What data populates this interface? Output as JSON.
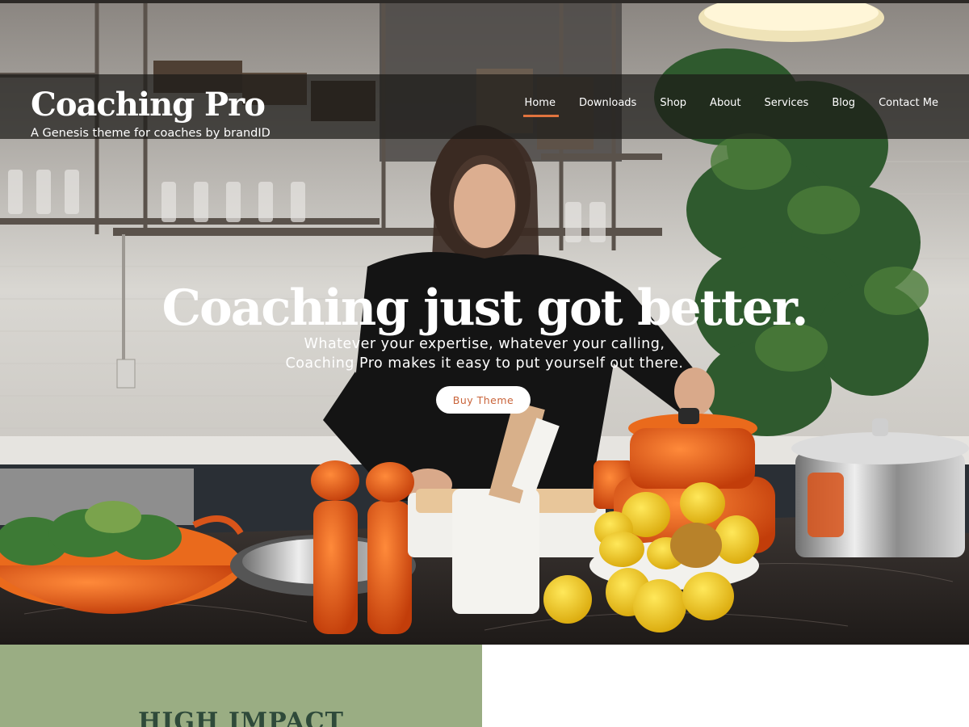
{
  "site": {
    "title": "Coaching Pro",
    "tagline": "A Genesis theme for coaches by brandID"
  },
  "nav": {
    "items": [
      {
        "label": "Home",
        "active": true
      },
      {
        "label": "Downloads",
        "active": false
      },
      {
        "label": "Shop",
        "active": false
      },
      {
        "label": "About",
        "active": false
      },
      {
        "label": "Services",
        "active": false
      },
      {
        "label": "Blog",
        "active": false
      },
      {
        "label": "Contact Me",
        "active": false
      }
    ]
  },
  "hero": {
    "headline": "Coaching just got better.",
    "subline_1": "Whatever your expertise, whatever your calling,",
    "subline_2": "Coaching Pro makes it easy to put yourself out there.",
    "button_label": "Buy Theme",
    "image_description_icon": "kitchen-photo"
  },
  "section": {
    "impact_title": "HIGH IMPACT"
  },
  "colors": {
    "accent": "#e0733e",
    "button_text": "#c9643a",
    "panel_green": "#9aad83",
    "heading_green": "#2f4a3a"
  }
}
